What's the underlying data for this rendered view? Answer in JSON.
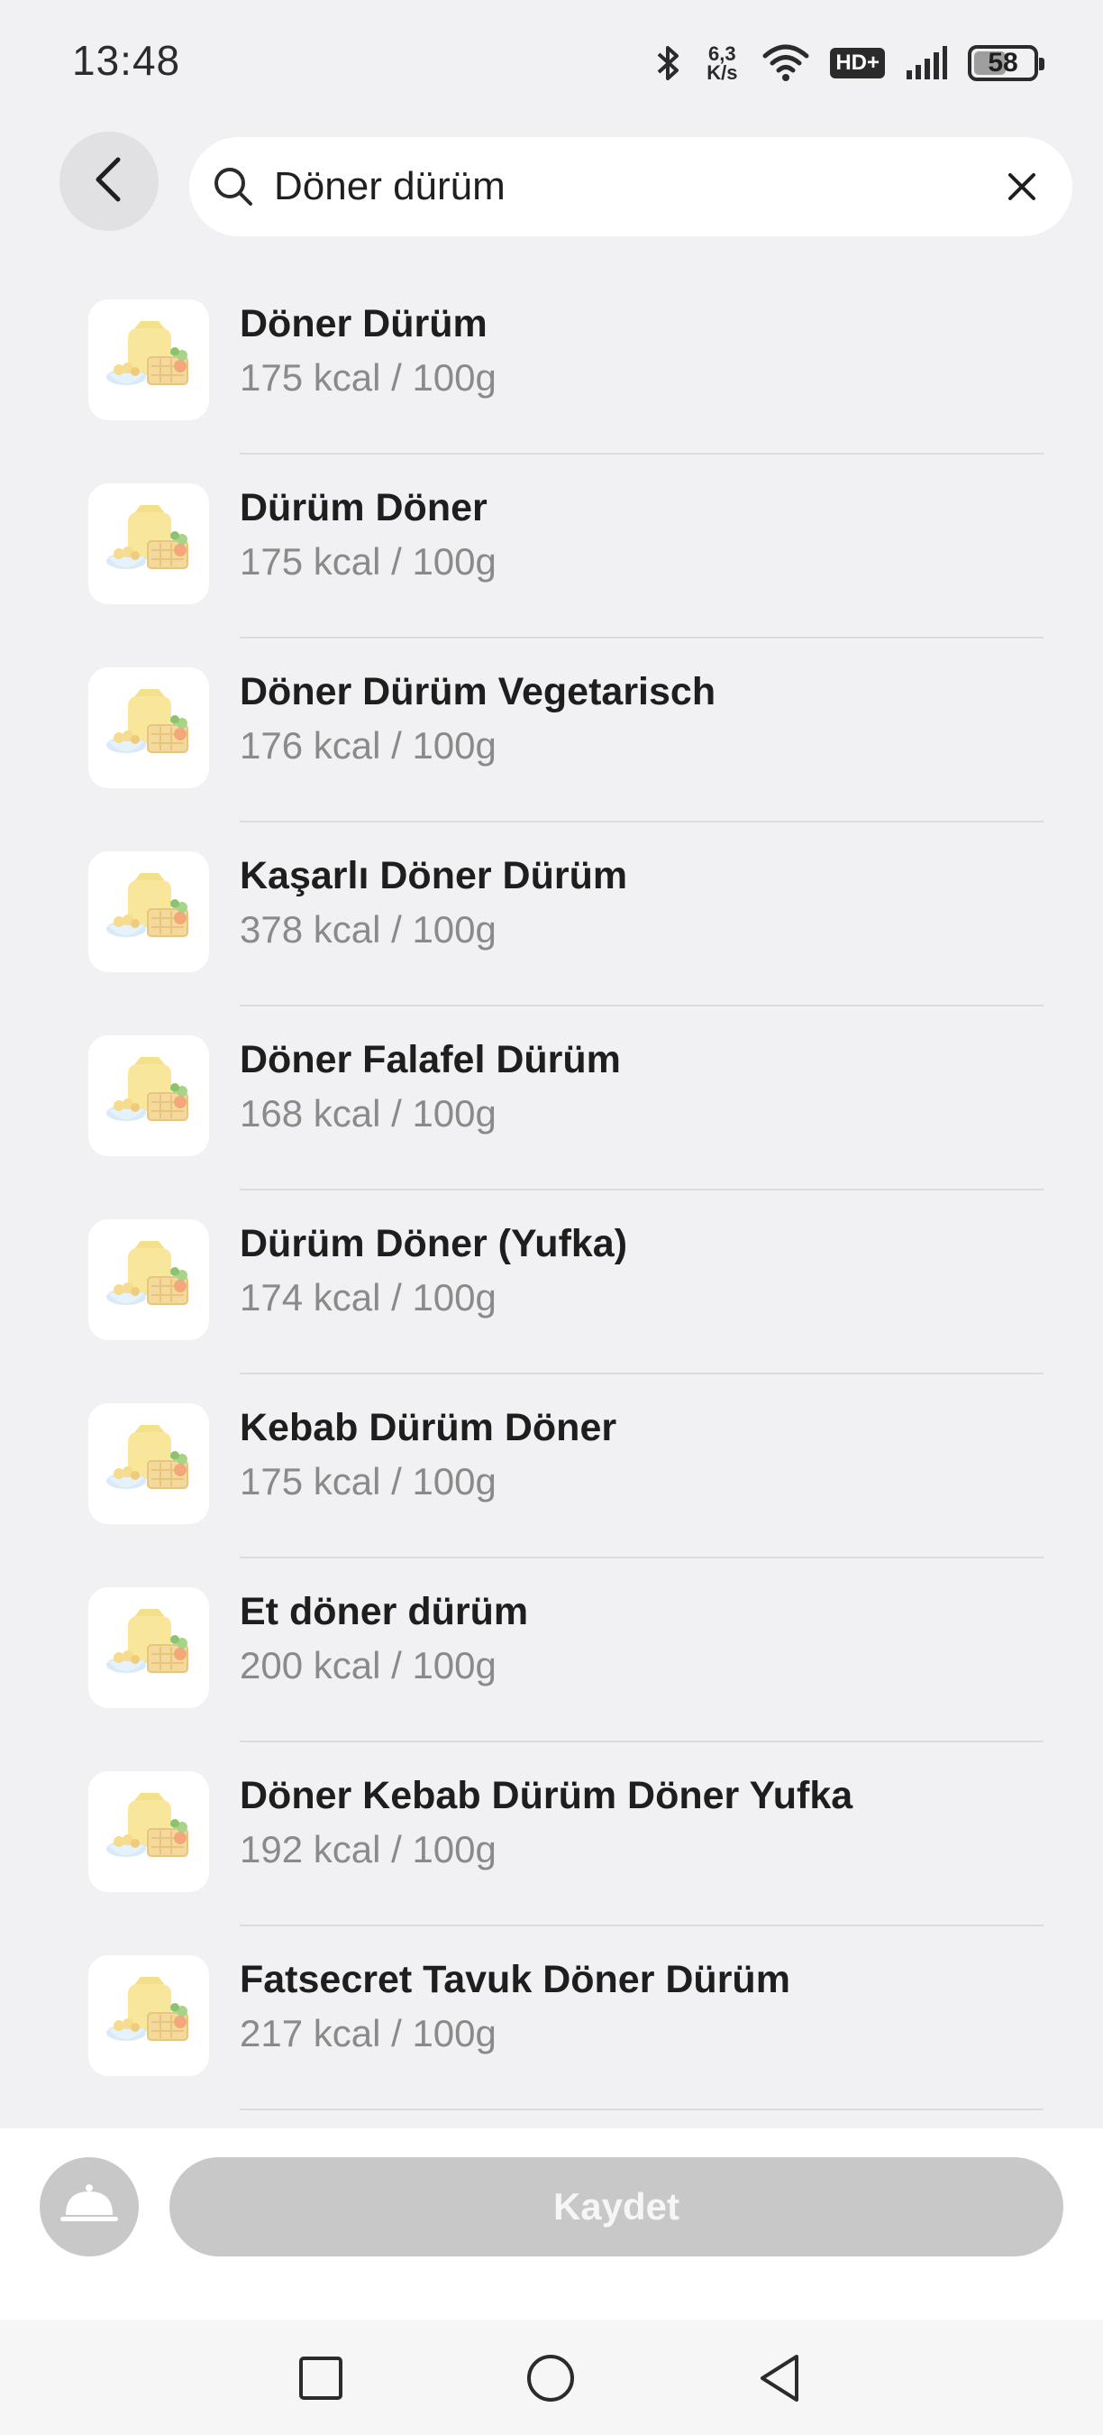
{
  "status_bar": {
    "time": "13:48",
    "net_speed_value": "6,3",
    "net_speed_unit": "K/s",
    "hd_label": "HD+",
    "battery_level": "58",
    "battery_fraction": 0.58
  },
  "search": {
    "query": "Döner dürüm",
    "back_icon": "chevron-left-icon",
    "search_icon": "magnifier-icon",
    "clear_icon": "close-icon"
  },
  "results": [
    {
      "name": "Döner Dürüm",
      "kcal": "175 kcal / 100g"
    },
    {
      "name": "Dürüm Döner",
      "kcal": "175 kcal / 100g"
    },
    {
      "name": "Döner Dürüm Vegetarisch",
      "kcal": "176 kcal / 100g"
    },
    {
      "name": "Kaşarlı Döner Dürüm",
      "kcal": "378 kcal / 100g"
    },
    {
      "name": "Döner Falafel Dürüm",
      "kcal": "168 kcal / 100g"
    },
    {
      "name": "Dürüm Döner (Yufka)",
      "kcal": "174 kcal / 100g"
    },
    {
      "name": "Kebab Dürüm Döner",
      "kcal": "175 kcal / 100g"
    },
    {
      "name": "Et döner dürüm",
      "kcal": "200 kcal / 100g"
    },
    {
      "name": "Döner Kebab Dürüm Döner Yufka",
      "kcal": "192 kcal / 100g"
    },
    {
      "name": "Fatsecret Tavuk Döner Dürüm",
      "kcal": "217 kcal / 100g"
    }
  ],
  "action_bar": {
    "save_label": "Kaydet",
    "meal_icon": "cloche-icon"
  },
  "colors": {
    "background": "#f1f1f3",
    "disabled_button": "#c8c8c8",
    "secondary_text": "#8a8a8a"
  }
}
